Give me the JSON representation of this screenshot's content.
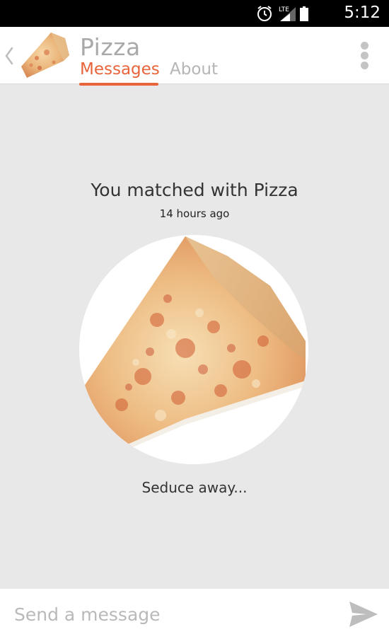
{
  "status_bar": {
    "time": "5:12",
    "network_label": "LTE",
    "icons": [
      "alarm-icon",
      "signal-icon",
      "battery-icon"
    ]
  },
  "header": {
    "title": "Pizza",
    "tabs": [
      {
        "label": "Messages",
        "active": true
      },
      {
        "label": "About",
        "active": false
      }
    ],
    "icons": [
      "chevron-left-icon",
      "overflow-menu-icon"
    ]
  },
  "match": {
    "text": "You matched with Pizza",
    "time_ago": "14 hours ago",
    "prompt": "Seduce away..."
  },
  "composer": {
    "placeholder": "Send a message",
    "value": "",
    "send_icon": "send-icon"
  },
  "colors": {
    "accent": "#e8643a",
    "background": "#e8e8e8",
    "header_bg": "#ffffff",
    "status_bar_bg": "#000000"
  }
}
